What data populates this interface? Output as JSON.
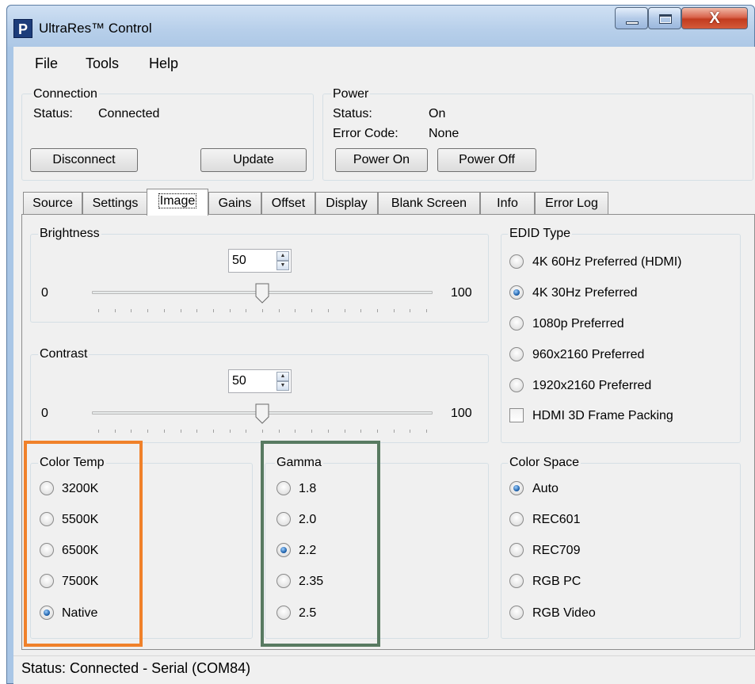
{
  "window": {
    "title": "UltraRes™ Control",
    "app_icon_letter": "P",
    "close_glyph": "X"
  },
  "menu": [
    "File",
    "Tools",
    "Help"
  ],
  "connection": {
    "group_label": "Connection",
    "status_label": "Status:",
    "status_value": "Connected",
    "disconnect_label": "Disconnect",
    "update_label": "Update"
  },
  "power": {
    "group_label": "Power",
    "status_label": "Status:",
    "status_value": "On",
    "error_label": "Error Code:",
    "error_value": "None",
    "power_on_label": "Power On",
    "power_off_label": "Power Off"
  },
  "tabs": [
    {
      "label": "Source",
      "active": false
    },
    {
      "label": "Settings",
      "active": false
    },
    {
      "label": "Image",
      "active": true
    },
    {
      "label": "Gains",
      "active": false
    },
    {
      "label": "Offset",
      "active": false
    },
    {
      "label": "Display",
      "active": false
    },
    {
      "label": "Blank Screen",
      "active": false
    },
    {
      "label": "Info",
      "active": false
    },
    {
      "label": "Error Log",
      "active": false
    }
  ],
  "brightness": {
    "label": "Brightness",
    "value": "50",
    "min": "0",
    "max": "100",
    "fraction": 0.5
  },
  "contrast": {
    "label": "Contrast",
    "value": "50",
    "min": "0",
    "max": "100",
    "fraction": 0.5
  },
  "edid": {
    "label": "EDID Type",
    "options": [
      {
        "label": "4K 60Hz Preferred (HDMI)",
        "selected": false
      },
      {
        "label": "4K 30Hz Preferred",
        "selected": true
      },
      {
        "label": "1080p Preferred",
        "selected": false
      },
      {
        "label": "960x2160 Preferred",
        "selected": false
      },
      {
        "label": "1920x2160 Preferred",
        "selected": false
      }
    ],
    "checkbox_label": "HDMI 3D Frame Packing",
    "checkbox_checked": false
  },
  "color_temp": {
    "label": "Color Temp",
    "options": [
      {
        "label": "3200K",
        "selected": false
      },
      {
        "label": "5500K",
        "selected": false
      },
      {
        "label": "6500K",
        "selected": false
      },
      {
        "label": "7500K",
        "selected": false
      },
      {
        "label": "Native",
        "selected": true
      }
    ]
  },
  "gamma": {
    "label": "Gamma",
    "options": [
      {
        "label": "1.8",
        "selected": false
      },
      {
        "label": "2.0",
        "selected": false
      },
      {
        "label": "2.2",
        "selected": true
      },
      {
        "label": "2.35",
        "selected": false
      },
      {
        "label": "2.5",
        "selected": false
      }
    ]
  },
  "color_space": {
    "label": "Color Space",
    "options": [
      {
        "label": "Auto",
        "selected": true
      },
      {
        "label": "REC601",
        "selected": false
      },
      {
        "label": "REC709",
        "selected": false
      },
      {
        "label": "RGB PC",
        "selected": false
      },
      {
        "label": "RGB Video",
        "selected": false
      }
    ]
  },
  "highlight_colors": {
    "color_temp": "#f0812a",
    "gamma": "#587a61"
  },
  "statusbar": {
    "text": "Status:  Connected - Serial (COM84)"
  }
}
